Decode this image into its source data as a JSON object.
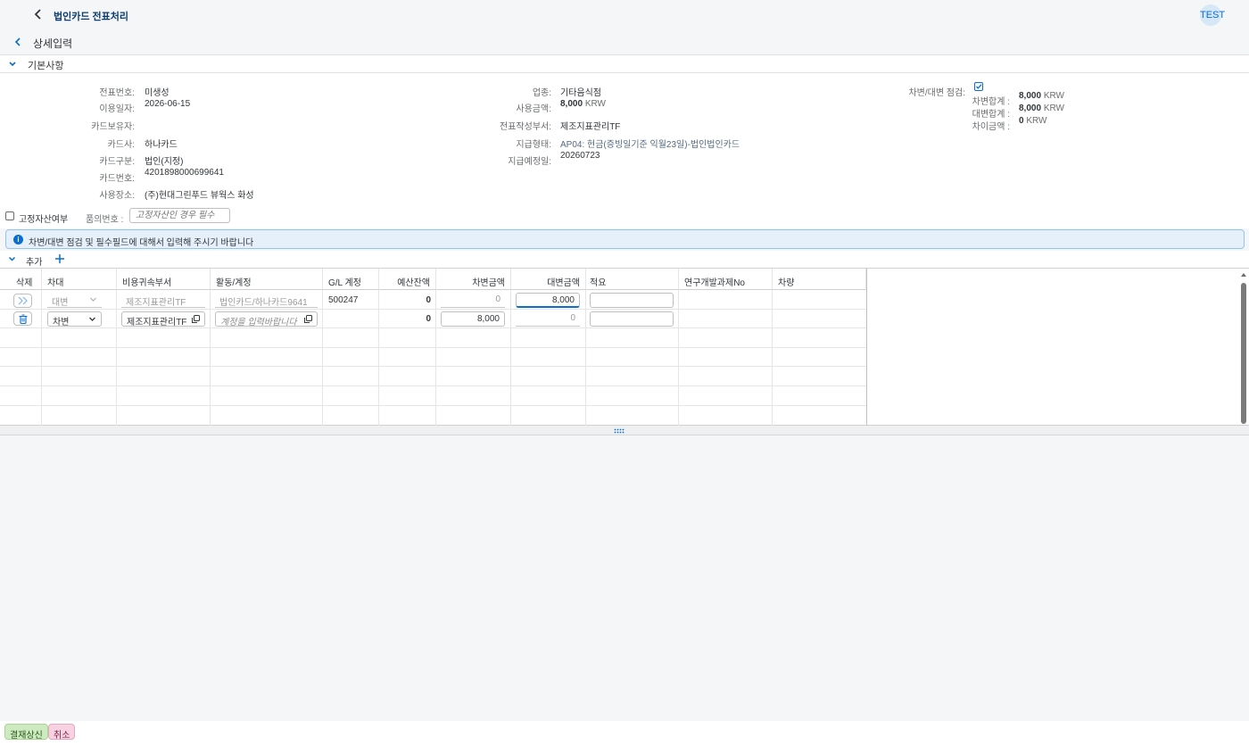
{
  "shell": {
    "title": "법인카드 전표처리",
    "user": "TEST"
  },
  "subheader": {
    "title": "상세입력"
  },
  "panel": {
    "title": "기본사항"
  },
  "form": {
    "col1": [
      {
        "label": "전표번호:",
        "value": "미생성"
      },
      {
        "label": "이용일자:",
        "value": "2026-06-15"
      },
      {
        "label": "카드보유자:",
        "value": ""
      },
      {
        "label": "카드사:",
        "value": "하나카드"
      },
      {
        "label": "카드구분:",
        "value": "법인(지정)"
      },
      {
        "label": "카드번호:",
        "value": "4201898000699641"
      },
      {
        "label": "사용장소:",
        "value": "(주)현대그린푸드 뷰웍스 화성"
      }
    ],
    "col2": {
      "biz_label": "업종:",
      "biz_value": "기타음식점",
      "amount_label": "사용금액:",
      "amount_value": "8,000",
      "amount_unit": "KRW",
      "dept_label": "전표작성부서:",
      "dept_value": "제조지표관리TF",
      "paytype_label": "지급형태:",
      "paytype_value": "AP04: 현금(증빙일기준 익월23일)-법인법인카드",
      "paydate_label": "지급예정일:",
      "paydate_value": "20260723"
    },
    "col3": {
      "check_label": "차변/대변 점검:",
      "debit_label": "차변합계 :",
      "debit_value": "8,000",
      "debit_unit": "KRW",
      "credit_label": "대변합계 :",
      "credit_value": "8,000",
      "credit_unit": "KRW",
      "diff_label": "차이금액 :",
      "diff_value": "0",
      "diff_unit": "KRW"
    }
  },
  "fixed_asset": {
    "label": "고정자산여부",
    "approval_label": "품의번호 :",
    "approval_placeholder": "고정자산인 경우 필수"
  },
  "info": {
    "message": "차변/대변 점검 및 필수필드에 대해서 입력해 주시기 바랍니다"
  },
  "table_toolbar": {
    "label": "추가"
  },
  "table": {
    "headers": [
      "삭제",
      "차대",
      "비용귀속부서",
      "활동/계정",
      "G/L 계정",
      "예산잔액",
      "차변금액",
      "대변금액",
      "적요",
      "연구개발과제No",
      "차량"
    ],
    "rows": [
      {
        "dc": "대변",
        "dept": "제조지표관리TF",
        "account": "법인카드/하나카드9641",
        "gl": "500247",
        "budget": "0",
        "debit": "0",
        "credit": "8,000",
        "memo": ""
      },
      {
        "dc": "차변",
        "dept": "제조지표관리TF",
        "account_placeholder": "계정을 입력바랍니다",
        "gl": "",
        "budget": "0",
        "debit": "8,000",
        "credit": "0",
        "memo": ""
      }
    ]
  },
  "footer": {
    "submit": "결재상신",
    "cancel": "취소"
  },
  "colors": {
    "accent": "#0a6ed1",
    "title": "#0a3b73"
  }
}
